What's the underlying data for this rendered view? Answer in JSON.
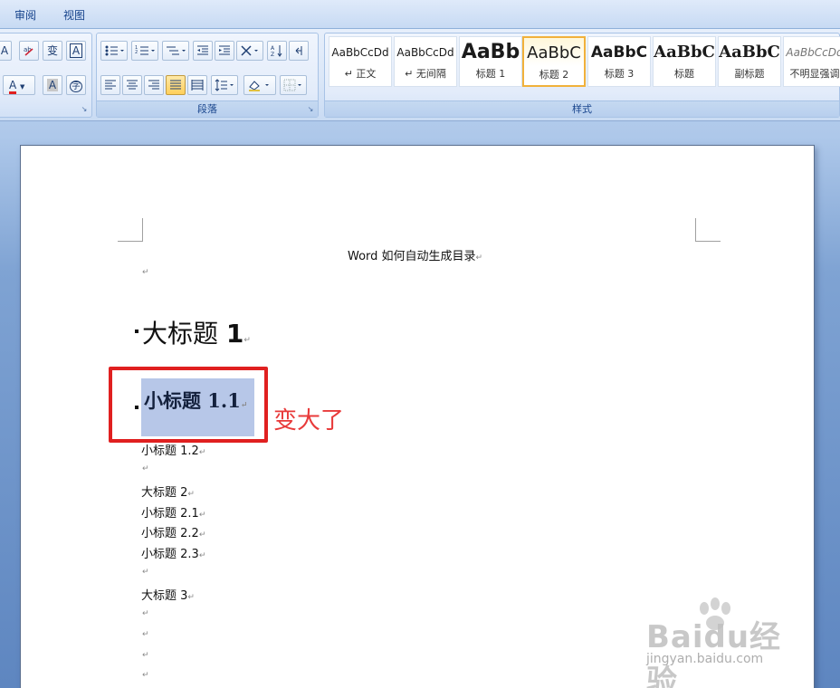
{
  "tabs": [
    "审阅",
    "视图"
  ],
  "ribbon": {
    "paragraph_group_label": "段落",
    "styles_group_label": "样式",
    "font_glyphs": {
      "grow": "A",
      "phonetic": "变",
      "border": "A",
      "font_color": "A",
      "shade": "A",
      "enclose": "字"
    },
    "styles": [
      {
        "sample": "AaBbCcDd",
        "name": "↵ 正文"
      },
      {
        "sample": "AaBbCcDd",
        "name": "↵ 无间隔"
      },
      {
        "sample": "AaBb",
        "name": "标题 1"
      },
      {
        "sample": "AaBbC",
        "name": "标题 2"
      },
      {
        "sample": "AaBbC",
        "name": "标题 3"
      },
      {
        "sample": "AaBbC",
        "name": "标题"
      },
      {
        "sample": "AaBbC",
        "name": "副标题"
      },
      {
        "sample": "AaBbCcDd",
        "name": "不明显强调"
      }
    ],
    "selected_style_index": 3
  },
  "document": {
    "title": "Word 如何自动生成目录",
    "heading1": {
      "text": "大标题 ",
      "num": "1"
    },
    "heading2": "小标题 1.1",
    "lines": [
      "小标题 1.2",
      "大标题 2",
      "小标题 2.1",
      "小标题 2.2",
      "小标题 2.3",
      "大标题 3"
    ],
    "para_mark": "↵"
  },
  "annotation": {
    "text": "变大了",
    "color": "#e83a3a"
  },
  "watermark": {
    "brand": "Baidu经验",
    "url": "jingyan.baidu.com"
  },
  "colors": {
    "selection": "#b7c7e8",
    "highlight_box": "#e02020",
    "selected_style_border": "#f1b13b"
  }
}
